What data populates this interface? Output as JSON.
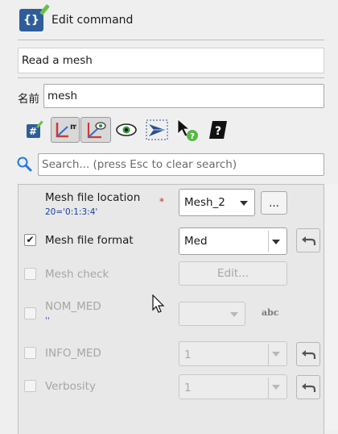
{
  "header": {
    "title": "Edit command",
    "icon": "edit-command-icon"
  },
  "command_description": "Read a mesh",
  "name_field": {
    "label": "名前",
    "value": "mesh"
  },
  "toolbar": {
    "buttons": [
      {
        "name": "command-edit-icon",
        "pressed": false
      },
      {
        "name": "concept-link-icon",
        "pressed": true
      },
      {
        "name": "hide-show-related-icon",
        "pressed": true
      },
      {
        "name": "eye-icon",
        "pressed": false
      },
      {
        "name": "view-3d-icon",
        "pressed": false
      },
      {
        "name": "whats-this-help-icon",
        "pressed": false
      },
      {
        "name": "documentation-icon",
        "pressed": false
      }
    ]
  },
  "search": {
    "placeholder": "Search... (press Esc to clear search)"
  },
  "params": {
    "mesh_file_location": {
      "label": "Mesh file location",
      "value_text": "20='0:1:3:4'",
      "required_mark": "*",
      "selected": "Mesh_2",
      "browse_label": "..."
    },
    "mesh_file_format": {
      "label": "Mesh file format",
      "checked": true,
      "check_mark": "✔",
      "selected": "Med"
    },
    "mesh_check": {
      "label": "Mesh check",
      "checked": false,
      "button_label": "Edit..."
    },
    "nom_med": {
      "label": "NOM_MED",
      "value_text": "''",
      "selected": "",
      "abc": "abc"
    },
    "info_med": {
      "label": "INFO_MED",
      "checked": false,
      "selected": "1"
    },
    "verbosity": {
      "label": "Verbosity",
      "checked": false,
      "selected": "1"
    }
  },
  "colors": {
    "accent": "#2f5d9a",
    "required": "#c62828",
    "link_text": "#1a3fa5"
  }
}
